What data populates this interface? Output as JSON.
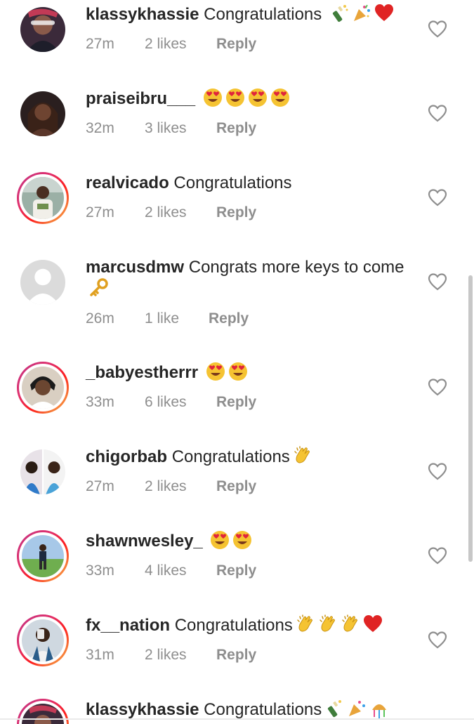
{
  "comments": [
    {
      "username": "klassykhassie",
      "text": "Congratulations",
      "emojis": [
        "bottle-with-popping-cork-emoji",
        "party-popper-emoji",
        "red-heart-emoji"
      ],
      "time": "27m",
      "likes": "2 likes",
      "reply": "Reply",
      "avatar": "profile-photo",
      "story_ring": false
    },
    {
      "username": "praiseibru___",
      "text": "",
      "emojis": [
        "heart-eyes-emoji",
        "heart-eyes-emoji",
        "heart-eyes-emoji",
        "heart-eyes-emoji"
      ],
      "time": "32m",
      "likes": "3 likes",
      "reply": "Reply",
      "avatar": "profile-photo",
      "story_ring": false
    },
    {
      "username": "realvicado",
      "text": "Congratulations",
      "emojis": [],
      "time": "27m",
      "likes": "2 likes",
      "reply": "Reply",
      "avatar": "profile-photo",
      "story_ring": true
    },
    {
      "username": "marcusdmw",
      "text": "Congrats more keys to come",
      "emojis": [
        "key-emoji"
      ],
      "time": "26m",
      "likes": "1 like",
      "reply": "Reply",
      "avatar": "default-avatar",
      "story_ring": false
    },
    {
      "username": "_babyestherrr",
      "text": "",
      "emojis": [
        "heart-eyes-emoji",
        "heart-eyes-emoji"
      ],
      "time": "33m",
      "likes": "6 likes",
      "reply": "Reply",
      "avatar": "profile-photo",
      "story_ring": true
    },
    {
      "username": "chigorbab",
      "text": "Congratulations",
      "emojis": [
        "clapping-hands-emoji"
      ],
      "time": "27m",
      "likes": "2 likes",
      "reply": "Reply",
      "avatar": "profile-photo",
      "story_ring": false
    },
    {
      "username": "shawnwesley_",
      "text": "",
      "emojis": [
        "heart-eyes-emoji",
        "heart-eyes-emoji"
      ],
      "time": "33m",
      "likes": "4 likes",
      "reply": "Reply",
      "avatar": "profile-photo",
      "story_ring": true
    },
    {
      "username": "fx__nation",
      "text": "Congratulations",
      "emojis": [
        "clapping-hands-emoji",
        "clapping-hands-emoji",
        "clapping-hands-emoji",
        "red-heart-emoji"
      ],
      "time": "31m",
      "likes": "2 likes",
      "reply": "Reply",
      "avatar": "profile-photo",
      "story_ring": true
    },
    {
      "username": "klassykhassie",
      "text": "Congratulations",
      "emojis": [
        "bottle-with-popping-cork-emoji",
        "party-popper-emoji",
        "confetti-ball-emoji"
      ],
      "time": "",
      "likes": "",
      "reply": "",
      "avatar": "profile-photo",
      "story_ring": true
    }
  ],
  "icons": {
    "like": "heart-outline-icon"
  },
  "colors": {
    "text": "#262626",
    "meta": "#8e8e8e",
    "story_ring_start": "#c13584",
    "story_ring_end": "#fcaf45",
    "heart_icon": "#8e8e8e",
    "scrollbar": "#c7c7c7"
  }
}
